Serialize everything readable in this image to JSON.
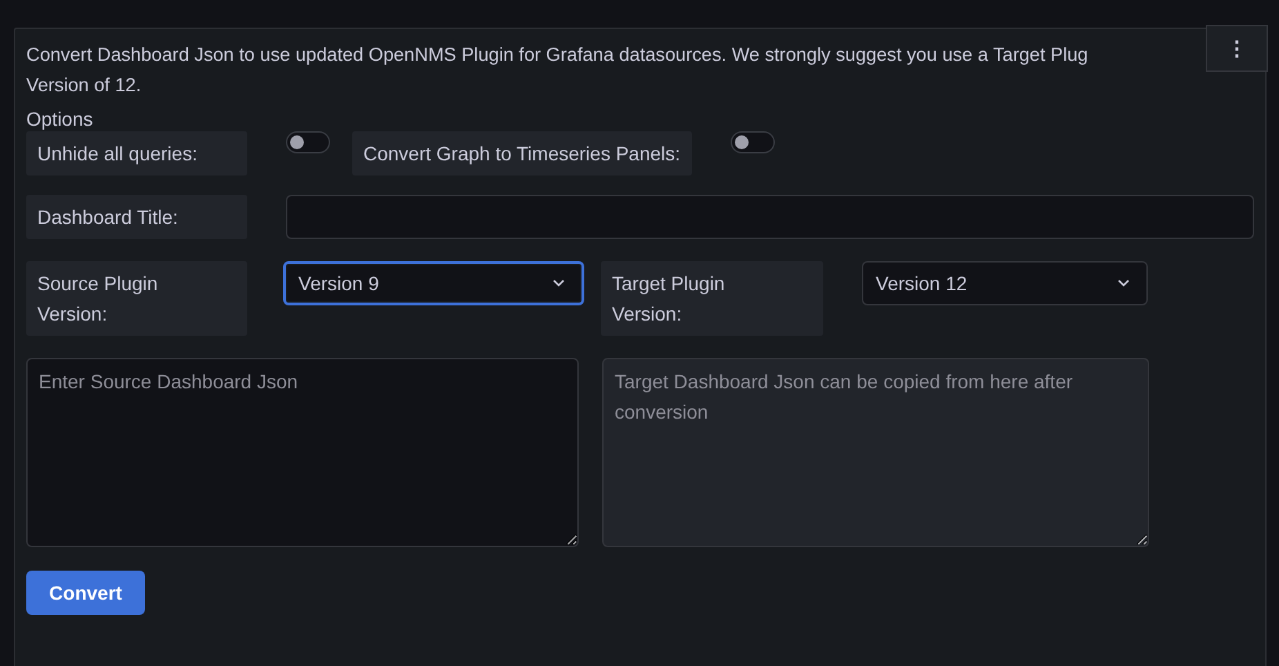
{
  "description": {
    "lines": [
      "Convert Dashboard Json to use updated OpenNMS Plugin for Grafana datasources. We strongly suggest you use a Target Plug",
      "Version of 12."
    ]
  },
  "menu_button": {
    "label": "⋮"
  },
  "options": {
    "heading": "Options",
    "toggles": [
      {
        "label": "Unhide all queries:",
        "on": false
      },
      {
        "label": "Convert Graph to Timeseries Panels:",
        "on": false
      }
    ]
  },
  "dashboard_title": {
    "label": "Dashboard Title:"
  },
  "plugin_versions": [
    {
      "label": "Source Plugin Version:",
      "value": "Version 9",
      "focused": true
    },
    {
      "label": "Target Plugin Version:",
      "value": "Version 12",
      "focused": false
    }
  ],
  "json_areas": [
    {
      "placeholder": "Enter Source Dashboard Json",
      "readonly": false
    },
    {
      "placeholder": "Target Dashboard Json can be copied from here after conversion",
      "readonly": true
    }
  ],
  "convert_button": {
    "label": "Convert"
  }
}
